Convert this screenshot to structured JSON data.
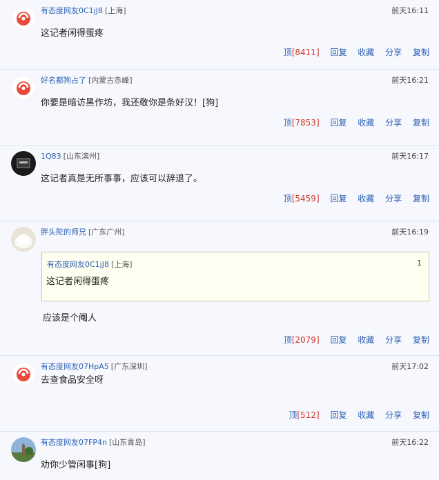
{
  "comments": [
    {
      "user": "有态度网友0C1jJ8",
      "location": "[上海]",
      "time": "前天16:11",
      "text": "这记者闲得蛋疼",
      "votes": "8411",
      "avatar": "netease-logo"
    },
    {
      "user": "好名都狗占了",
      "location": "[内蒙古赤峰]",
      "time": "前天16:21",
      "text": "你要是暗访黑作坊，我还敬你是条好汉！[狗]",
      "votes": "7853",
      "avatar": "netease-logo"
    },
    {
      "user": "1Q83",
      "location": "[山东滨州]",
      "time": "前天16:17",
      "text": "这记者真是无所事事，应该可以辞退了。",
      "votes": "5459",
      "avatar": "photo-dark"
    },
    {
      "user": "胖头陀的师兄",
      "location": "[广东广州]",
      "time": "前天16:19",
      "text": "应该是个阉人",
      "votes": "2079",
      "avatar": "photo-light",
      "quote": {
        "user": "有态度网友0C1jJ8",
        "location": "[上海]",
        "floor": "1",
        "text": "这记者闲得蛋疼"
      }
    },
    {
      "user": "有态度网友07HpA5",
      "location": "[广东深圳]",
      "time": "前天17:02",
      "text": "去查食品安全呀",
      "votes": "512",
      "avatar": "netease-logo"
    },
    {
      "user": "有态度网友07FP4n",
      "location": "[山东青岛]",
      "time": "前天16:22",
      "text": "劝你少管闲事[狗]",
      "votes": "",
      "avatar": "photo-landscape"
    }
  ],
  "actions": {
    "upvote": "顶",
    "reply": "回复",
    "favorite": "收藏",
    "share": "分享",
    "copy": "复制"
  },
  "colors": {
    "link": "#2b5fb3",
    "count": "#d0372b",
    "background": "#f6f8fd"
  }
}
